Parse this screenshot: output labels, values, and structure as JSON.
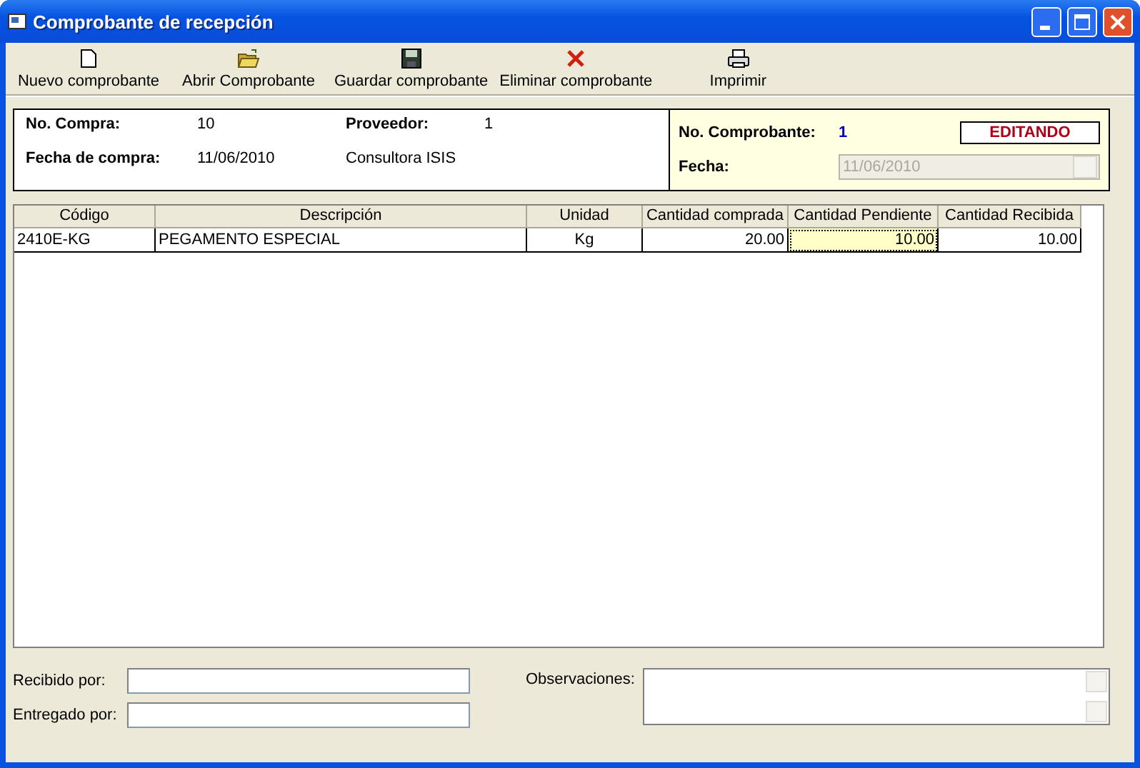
{
  "window": {
    "title": "Comprobante de recepción"
  },
  "toolbar": [
    {
      "kind": "new",
      "label": "Nuevo comprobante"
    },
    {
      "kind": "open",
      "label": "Abrir Comprobante"
    },
    {
      "kind": "save",
      "label": "Guardar comprobante"
    },
    {
      "kind": "delete",
      "label": "Eliminar comprobante"
    },
    {
      "kind": "print",
      "label": "Imprimir"
    }
  ],
  "purchase": {
    "number_label": "No. Compra:",
    "number": "10",
    "supplier_label": "Proveedor:",
    "supplier": "1",
    "date_label": "Fecha de compra:",
    "date": "11/06/2010",
    "supplier_name": "Consultora ISIS"
  },
  "voucher": {
    "number_label": "No. Comprobante:",
    "number": "1",
    "status": "EDITANDO",
    "date_label": "Fecha:",
    "date": "11/06/2010",
    "date_disabled": true
  },
  "table": {
    "columns": [
      "Código",
      "Descripción",
      "Unidad",
      "Cantidad comprada",
      "Cantidad Pendiente",
      "Cantidad Recibida"
    ],
    "rows": [
      {
        "cells": [
          {
            "text": "2410E-KG",
            "selected": false
          },
          {
            "text": "PEGAMENTO ESPECIAL",
            "selected": false
          },
          {
            "text": "Kg",
            "selected": false
          },
          {
            "text": "20.00",
            "selected": false
          },
          {
            "text": "10.00",
            "selected": true
          },
          {
            "text": "10.00",
            "selected": false
          }
        ]
      }
    ]
  },
  "footer": {
    "received_label": "Recibido por:",
    "delivered_label": "Entregado por:",
    "notes_label": "Observaciones:"
  }
}
